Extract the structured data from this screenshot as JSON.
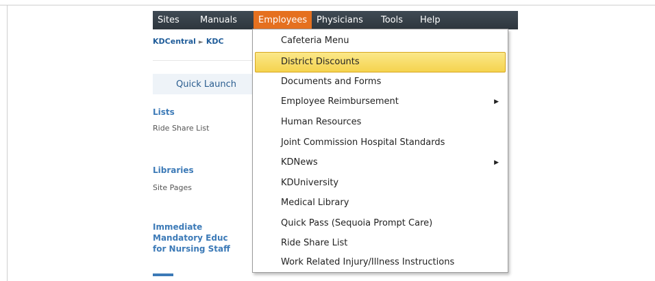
{
  "topnav": {
    "items": [
      {
        "label": "Sites",
        "active": false
      },
      {
        "label": "Manuals",
        "active": false
      },
      {
        "label": "Employees",
        "active": true
      },
      {
        "label": "Physicians",
        "active": false
      },
      {
        "label": "Tools",
        "active": false
      },
      {
        "label": "Help",
        "active": false
      }
    ]
  },
  "breadcrumb": {
    "root": "KDCentral",
    "current": "KDC"
  },
  "quick_launch": {
    "title": "Quick Launch"
  },
  "left_nav": {
    "lists_heading": "Lists",
    "lists_item": "Ride Share List",
    "libraries_heading": "Libraries",
    "libraries_item": "Site Pages",
    "immediate_line1": "Immediate",
    "immediate_line2": "Mandatory Educ",
    "immediate_line3": "for Nursing Staff"
  },
  "employees_menu": {
    "items": [
      {
        "label": "Cafeteria Menu",
        "submenu": false,
        "highlighted": false
      },
      {
        "label": "District Discounts",
        "submenu": false,
        "highlighted": true
      },
      {
        "label": "Documents and Forms",
        "submenu": false,
        "highlighted": false
      },
      {
        "label": "Employee Reimbursement",
        "submenu": true,
        "highlighted": false
      },
      {
        "label": "Human Resources",
        "submenu": false,
        "highlighted": false
      },
      {
        "label": "Joint Commission Hospital Standards",
        "submenu": false,
        "highlighted": false
      },
      {
        "label": "KDNews",
        "submenu": true,
        "highlighted": false
      },
      {
        "label": "KDUniversity",
        "submenu": false,
        "highlighted": false
      },
      {
        "label": "Medical Library",
        "submenu": false,
        "highlighted": false
      },
      {
        "label": "Quick Pass (Sequoia Prompt Care)",
        "submenu": false,
        "highlighted": false
      },
      {
        "label": "Ride Share List",
        "submenu": false,
        "highlighted": false
      },
      {
        "label": "Work Related Injury/Illness Instructions",
        "submenu": false,
        "highlighted": false
      }
    ]
  },
  "colors": {
    "nav_bg": "#3a444d",
    "active_tab": "#e5701f",
    "highlight": "#f8df6a",
    "link_blue": "#3c7ab7"
  }
}
